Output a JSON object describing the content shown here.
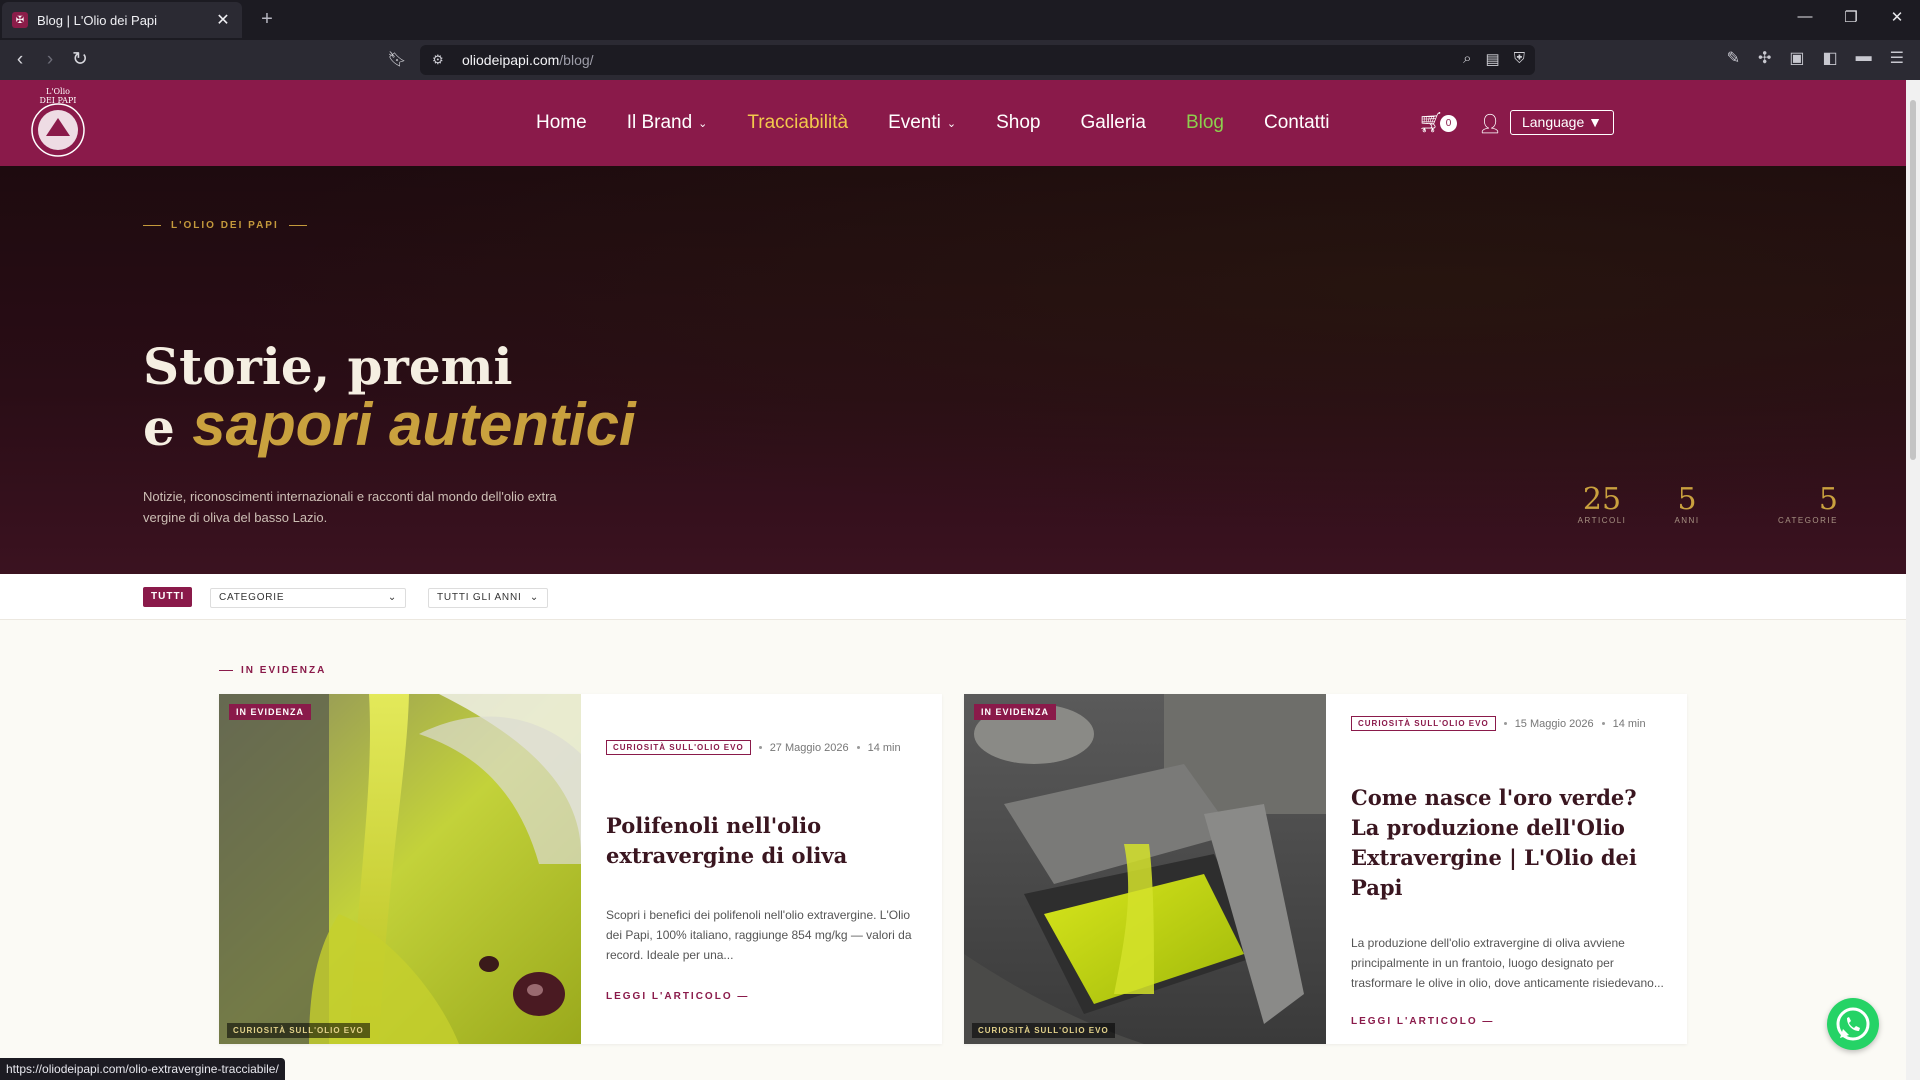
{
  "browser": {
    "tab_title": "Blog | L'Olio dei Papi",
    "url_domain": "oliodeipapi.com",
    "url_path": "/blog/",
    "status_url": "https://oliodeipapi.com/olio-extravergine-tracciabile/"
  },
  "header": {
    "nav": [
      {
        "label": "Home"
      },
      {
        "label": "Il Brand"
      },
      {
        "label": "Tracciabilità"
      },
      {
        "label": "Eventi"
      },
      {
        "label": "Shop"
      },
      {
        "label": "Galleria"
      },
      {
        "label": "Blog"
      },
      {
        "label": "Contatti"
      }
    ],
    "cart_count": "0",
    "language_label": "Language ▼"
  },
  "hero": {
    "eyebrow": "L'OLIO DEI PAPI",
    "title_line1": "Storie, premi",
    "title_line2_prefix": "e",
    "title_line2_accent": "sapori autentici",
    "subtitle": "Notizie, riconoscimenti internazionali e racconti dal mondo dell'olio extra vergine di oliva del basso Lazio.",
    "stats": [
      {
        "value": "25",
        "label": "ARTICOLI"
      },
      {
        "value": "5",
        "label": "ANNI"
      },
      {
        "value": "5",
        "label": "CATEGORIE"
      }
    ]
  },
  "filters": {
    "all_label": "TUTTI",
    "category_label": "CATEGORIE",
    "year_label": "TUTTI GLI ANNI"
  },
  "featured": {
    "section_label": "IN EVIDENZA",
    "cards": [
      {
        "badge": "IN EVIDENZA",
        "image_category": "CURIOSITÀ SULL'OLIO EVO",
        "category": "CURIOSITÀ SULL'OLIO EVO",
        "date": "27 Maggio 2026",
        "read_time": "14 min",
        "title": "Polifenoli nell'olio extravergine di oliva",
        "excerpt": "Scopri i benefici dei polifenoli nell'olio extravergine. L'Olio dei Papi, 100% italiano, raggiunge 854 mg/kg — valori da record. Ideale per una...",
        "read_more": "LEGGI L'ARTICOLO —"
      },
      {
        "badge": "IN EVIDENZA",
        "image_category": "CURIOSITÀ SULL'OLIO EVO",
        "category": "CURIOSITÀ SULL'OLIO EVO",
        "date": "15 Maggio 2026",
        "read_time": "14 min",
        "title": "Come nasce l'oro verde? La produzione dell'Olio Extravergine | L'Olio dei Papi",
        "excerpt": "La produzione dell'olio extravergine di oliva avviene principalmente in un frantoio, luogo designato per trasformare le olive in olio, dove anticamente risiedevano...",
        "read_more": "LEGGI L'ARTICOLO —"
      }
    ]
  },
  "colors": {
    "brand": "#8a1a4a",
    "gold": "#c9a13e",
    "nav_active": "#8ccf4d",
    "nav_highlight": "#f2c94c"
  }
}
